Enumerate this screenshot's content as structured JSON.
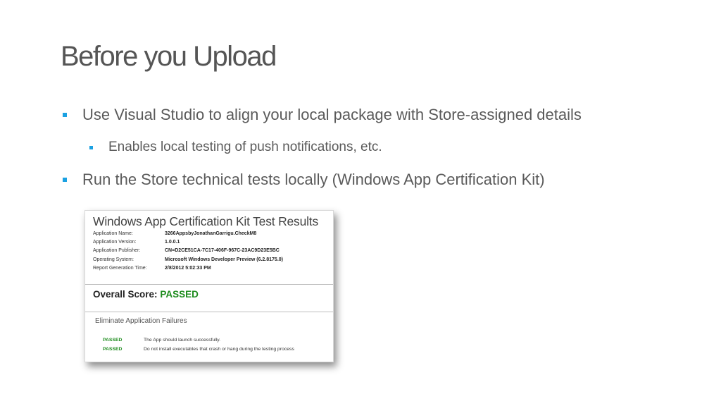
{
  "slide": {
    "title": "Before you Upload",
    "bullets": [
      {
        "level": 1,
        "text": "Use Visual Studio to align your local package with Store-assigned details"
      },
      {
        "level": 2,
        "text": "Enables local testing of push notifications, etc."
      },
      {
        "level": 1,
        "text": "Run the Store technical tests locally  (Windows App Certification Kit)"
      }
    ],
    "accent_color": "#1ba1e2"
  },
  "report": {
    "title": "Windows App Certification Kit Test Results",
    "meta": [
      {
        "label": "Application Name:",
        "value": "3266AppsbyJonathanGarrigu.CheckM8"
      },
      {
        "label": "Application Version:",
        "value": "1.0.0.1"
      },
      {
        "label": "Application Publisher:",
        "value": "CN=D2CE51CA-7C17-406F-967C-23AC9D23E5BC"
      },
      {
        "label": "Operating System:",
        "value": "Microsoft Windows Developer Preview (6.2.8175.0)"
      },
      {
        "label": "Report Generation Time:",
        "value": "2/8/2012 5:02:33 PM"
      }
    ],
    "score_label": "Overall Score:",
    "score_value": "PASSED",
    "pass_color": "#1e8c1e",
    "section_heading": "Eliminate Application Failures",
    "results": [
      {
        "status": "PASSED",
        "description": "The App should launch successfully."
      },
      {
        "status": "PASSED",
        "description": "Do not install executables that crash or hang during the testing process"
      }
    ]
  }
}
